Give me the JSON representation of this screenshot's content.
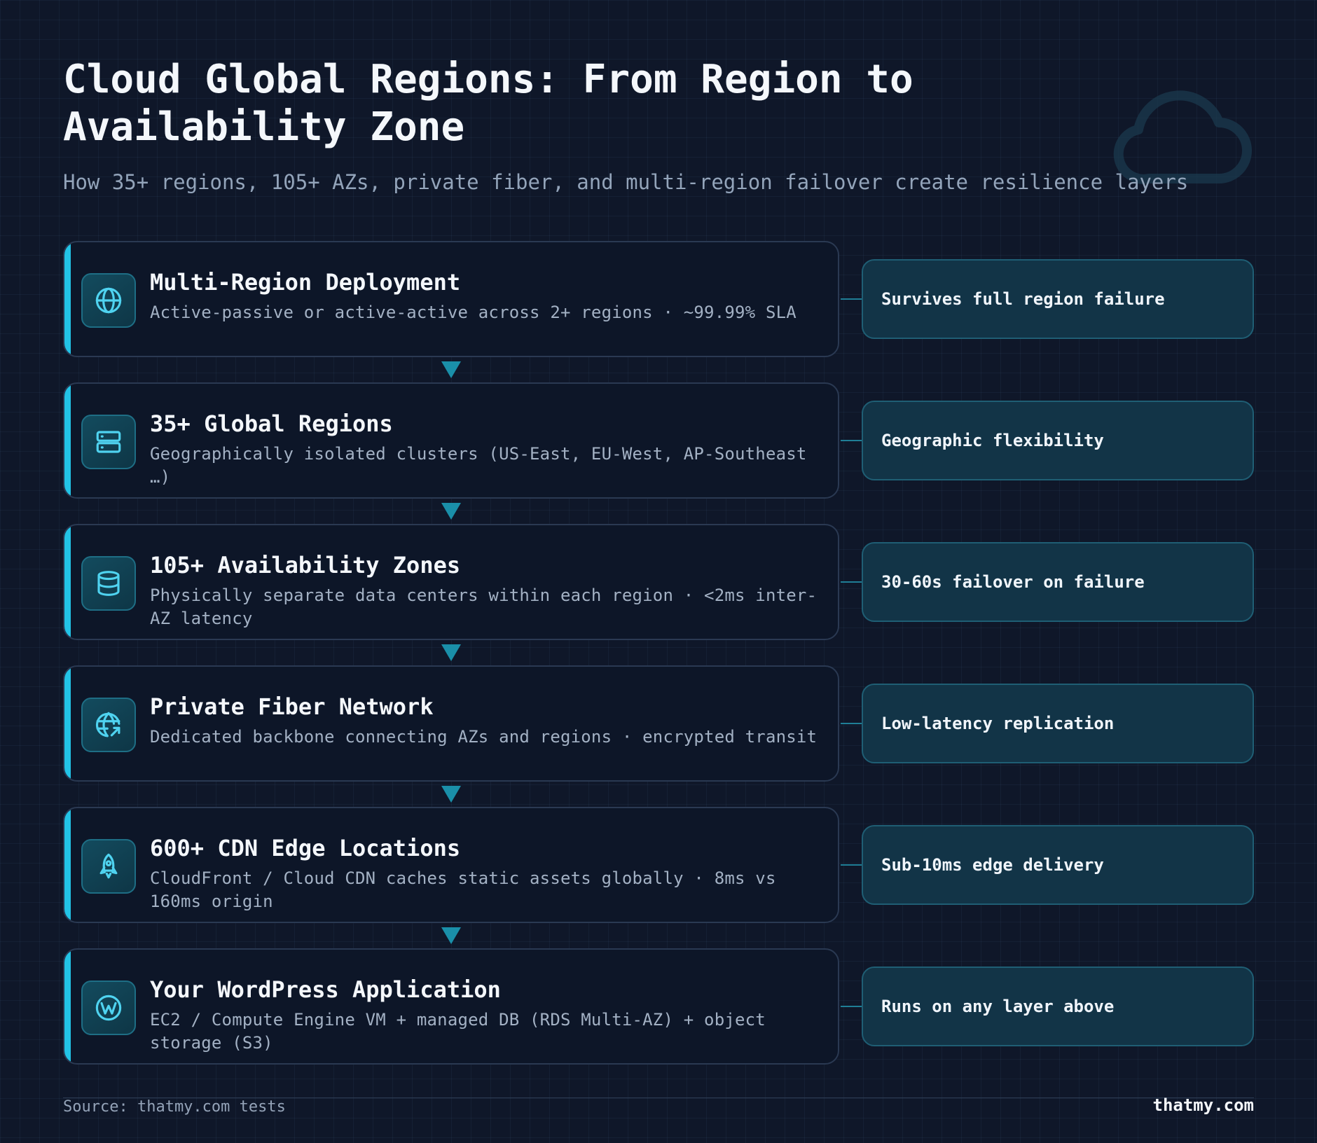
{
  "header": {
    "title": "Cloud Global Regions: From Region to Availability Zone",
    "subtitle": "How 35+ regions, 105+ AZs, private fiber, and multi-region failover create resilience layers"
  },
  "layers": [
    {
      "title": "Multi-Region Deployment",
      "description": "Active-passive or active-active across 2+ regions · ~99.99% SLA",
      "outcome": "Survives full region failure",
      "icon": "globe-icon"
    },
    {
      "title": "35+ Global Regions",
      "description": "Geographically isolated clusters (US-East, EU-West, AP-Southeast …)",
      "outcome": "Geographic flexibility",
      "icon": "server-icon"
    },
    {
      "title": "105+ Availability Zones",
      "description": "Physically separate data centers within each region · <2ms inter-AZ latency",
      "outcome": "30-60s failover on failure",
      "icon": "database-icon"
    },
    {
      "title": "Private Fiber Network",
      "description": "Dedicated backbone connecting AZs and regions · encrypted transit",
      "outcome": "Low-latency replication",
      "icon": "network-globe-icon"
    },
    {
      "title": "600+ CDN Edge Locations",
      "description": "CloudFront / Cloud CDN caches static assets globally · 8ms vs 160ms origin",
      "outcome": "Sub-10ms edge delivery",
      "icon": "rocket-icon"
    },
    {
      "title": "Your WordPress Application",
      "description": "EC2 / Compute Engine VM + managed DB (RDS Multi-AZ) + object storage (S3)",
      "outcome": "Runs on any layer above",
      "icon": "wordpress-icon"
    }
  ],
  "footer": {
    "source": "Source: thatmy.com tests",
    "brand": "thatmy.com"
  },
  "colors": {
    "background": "#0f1729",
    "card": "#0d1628",
    "accent": "#22c3e6",
    "outcome_box": "#123447"
  }
}
